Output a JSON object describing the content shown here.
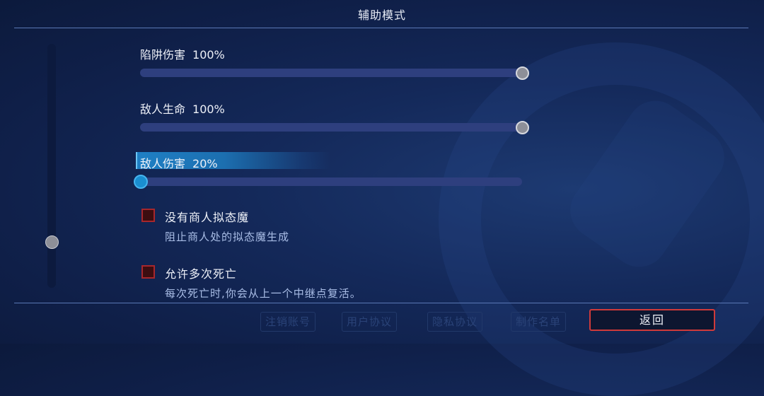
{
  "title": "辅助模式",
  "sliders": [
    {
      "label": "陷阱伤害",
      "value": "100%",
      "fraction": 1.0
    },
    {
      "label": "敌人生命",
      "value": "100%",
      "fraction": 1.0
    },
    {
      "label": "敌人伤害",
      "value": "20%",
      "fraction": 0.0,
      "focused": true
    }
  ],
  "toggles": [
    {
      "label": "没有商人拟态魔",
      "description": "阻止商人处的拟态魔生成",
      "checked": false
    },
    {
      "label": "允许多次死亡",
      "description": "每次死亡时,你会从上一个中继点复活。",
      "checked": false
    }
  ],
  "footer": {
    "links": [
      "注销账号",
      "用户协议",
      "隐私协议",
      "制作名单"
    ],
    "back_label": "返回"
  },
  "colors": {
    "background": "#14295a",
    "focus_accent": "#1f7fc4",
    "checkbox_border": "#a7272c",
    "back_button_border": "#cf3a3a"
  }
}
